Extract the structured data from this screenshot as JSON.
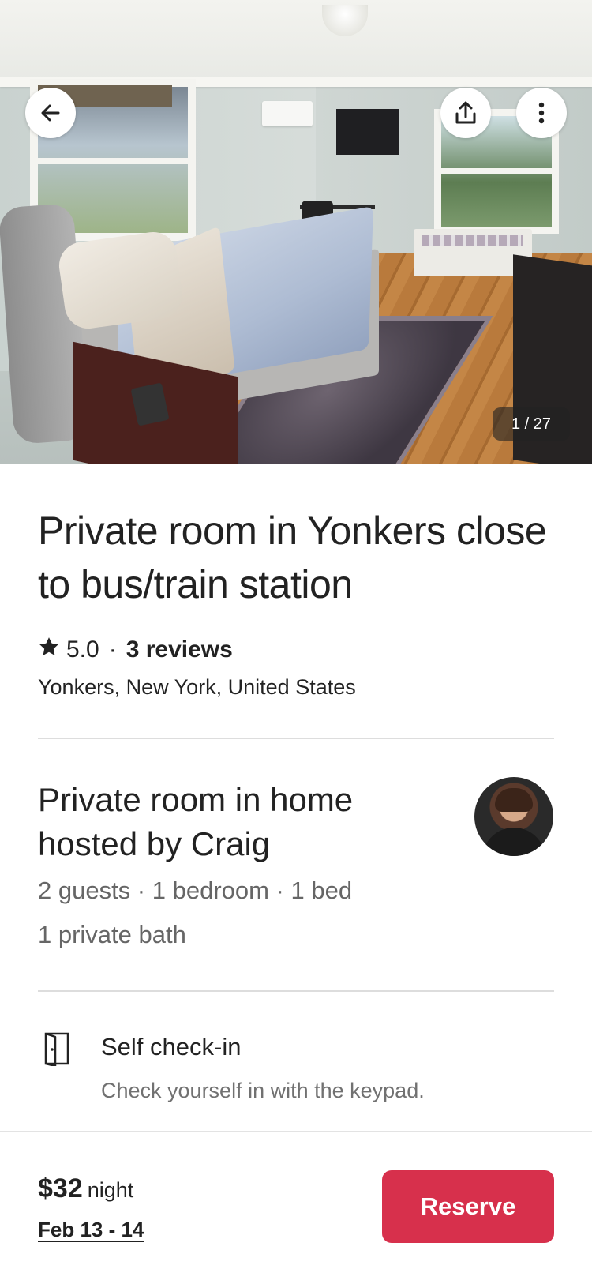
{
  "gallery": {
    "counter": "1 / 27"
  },
  "header_actions": {
    "back_icon": "arrow-left-icon",
    "share_icon": "share-icon",
    "more_icon": "more-vertical-icon"
  },
  "listing": {
    "title": "Private room in Yonkers close to bus/train station",
    "rating": "5.0",
    "separator": "·",
    "reviews_label": "3 reviews",
    "location": "Yonkers, New York, United States"
  },
  "host": {
    "title": "Private room in home hosted by Craig",
    "specs": "2 guests · 1 bedroom · 1 bed",
    "bath": "1 private bath"
  },
  "highlights": [
    {
      "icon": "door-icon",
      "title": "Self check-in",
      "subtitle": "Check yourself in with the keypad."
    }
  ],
  "footer": {
    "price": "$32",
    "unit": "night",
    "dates": "Feb 13 - 14",
    "reserve_label": "Reserve"
  },
  "colors": {
    "brand": "#d7304c",
    "text": "#222222",
    "muted": "#717171",
    "divider": "#dddddd"
  }
}
